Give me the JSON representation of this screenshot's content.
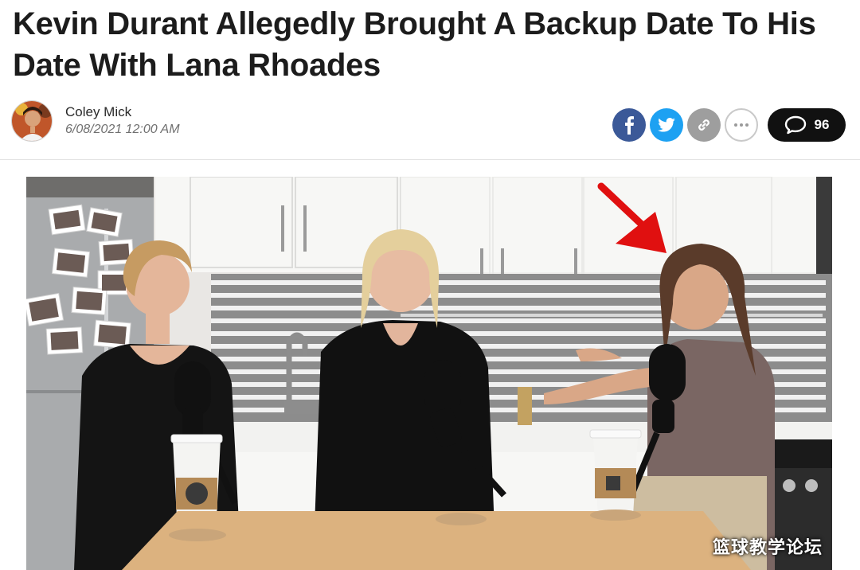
{
  "article": {
    "headline": "Kevin Durant Allegedly Brought A Backup Date To His Date With Lana Rhoades",
    "author": "Coley Mick",
    "date": "6/08/2021 12:00 AM"
  },
  "share": {
    "facebook_icon": "facebook-icon",
    "twitter_icon": "twitter-icon",
    "link_icon": "link-icon",
    "more_icon": "more-icon",
    "comment_icon": "comment-icon",
    "comment_count": "96",
    "colors": {
      "facebook": "#3b5998",
      "twitter": "#1da1f2",
      "link": "#9e9e9e",
      "comments": "#111111"
    }
  },
  "image": {
    "watermark": "篮球教学论坛",
    "annotation": "red-arrow-icon"
  }
}
